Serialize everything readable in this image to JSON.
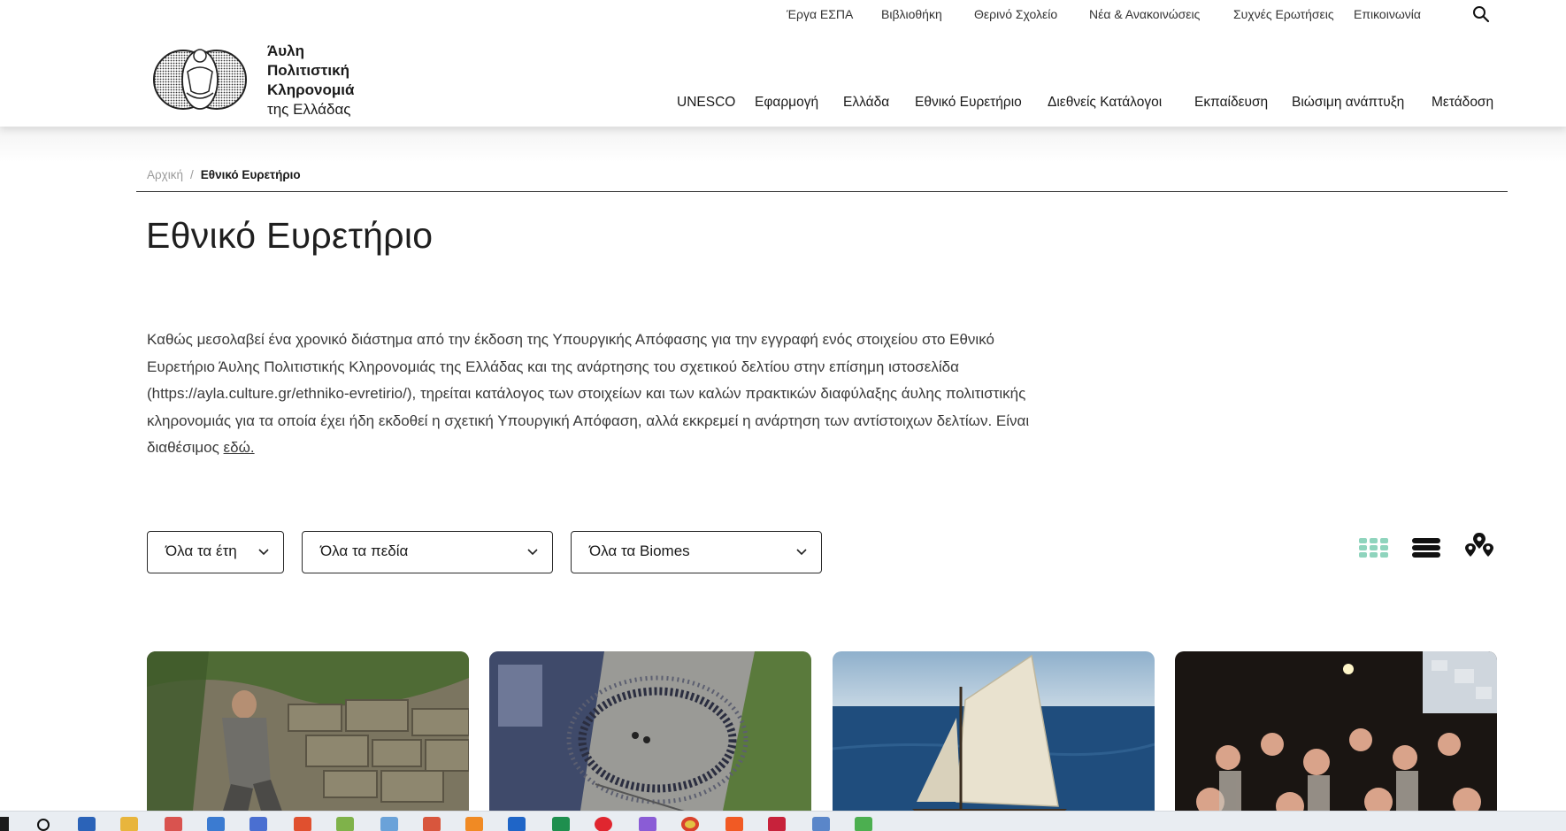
{
  "utility_nav": {
    "items": [
      {
        "label": "Έργα ΕΣΠΑ"
      },
      {
        "label": "Βιβλιοθήκη"
      },
      {
        "label": "Θερινό Σχολείο"
      },
      {
        "label": "Νέα & Ανακοινώσεις"
      },
      {
        "label": "Συχνές Ερωτήσεις"
      },
      {
        "label": "Επικοινωνία"
      }
    ],
    "search_icon": "search-icon"
  },
  "logo": {
    "line1": "Άυλη",
    "line2": "Πολιτιστική",
    "line3": "Κληρονομιά",
    "line4": "της Ελλάδας"
  },
  "main_nav": {
    "items": [
      {
        "label": "UNESCO"
      },
      {
        "label": "Εφαρμογή"
      },
      {
        "label": "Ελλάδα"
      },
      {
        "label": "Εθνικό Ευρετήριο"
      },
      {
        "label": "Διεθνείς Κατάλογοι"
      },
      {
        "label": "Εκπαίδευση"
      },
      {
        "label": "Βιώσιμη ανάπτυξη"
      },
      {
        "label": "Μετάδοση"
      }
    ]
  },
  "breadcrumb": {
    "home": "Αρχική",
    "separator": "/",
    "current": "Εθνικό Ευρετήριο"
  },
  "page": {
    "title": "Εθνικό Ευρετήριο",
    "intro": "Καθώς μεσολαβεί ένα χρονικό διάστημα από την έκδοση της Υπουργικής Απόφασης για την εγγραφή ενός στοιχείου στο Εθνικό Ευρετήριο Άυλης Πολιτιστικής Κληρονομιάς της Ελλάδας και της ανάρτησης του σχετικού δελτίου στην επίσημη ιστοσελίδα (https://ayla.culture.gr/ethniko-evretirio/), τηρείται κατάλογος των στοιχείων και των καλών πρακτικών διαφύλαξης άυλης πολιτιστικής κληρονομιάς για τα οποία έχει ήδη εκδοθεί η σχετική Υπουργική Απόφαση, αλλά εκκρεμεί η ανάρτηση των αντίστοιχων δελτίων. Είναι διαθέσιμος ",
    "intro_link": "εδώ."
  },
  "filters": {
    "years": {
      "selected": "Όλα τα έτη"
    },
    "fields": {
      "selected": "Όλα τα πεδία"
    },
    "biomes": {
      "selected": "Όλα τα Biomes"
    }
  },
  "view_toggles": {
    "grid": {
      "icon": "grid-view-icon",
      "active": true,
      "color": "#8fd4bd"
    },
    "list": {
      "icon": "list-view-icon",
      "active": false
    },
    "map": {
      "icon": "map-view-icon",
      "active": false
    }
  },
  "cards": [
    {
      "image": "stone-wall-worker"
    },
    {
      "image": "aerial-circle-dance-square"
    },
    {
      "image": "sailboat-at-sea"
    },
    {
      "image": "night-dance-crowd"
    }
  ],
  "colors": {
    "accent": "#8fd4bd",
    "text": "#1a1a1a",
    "muted": "#9a9a9a"
  }
}
